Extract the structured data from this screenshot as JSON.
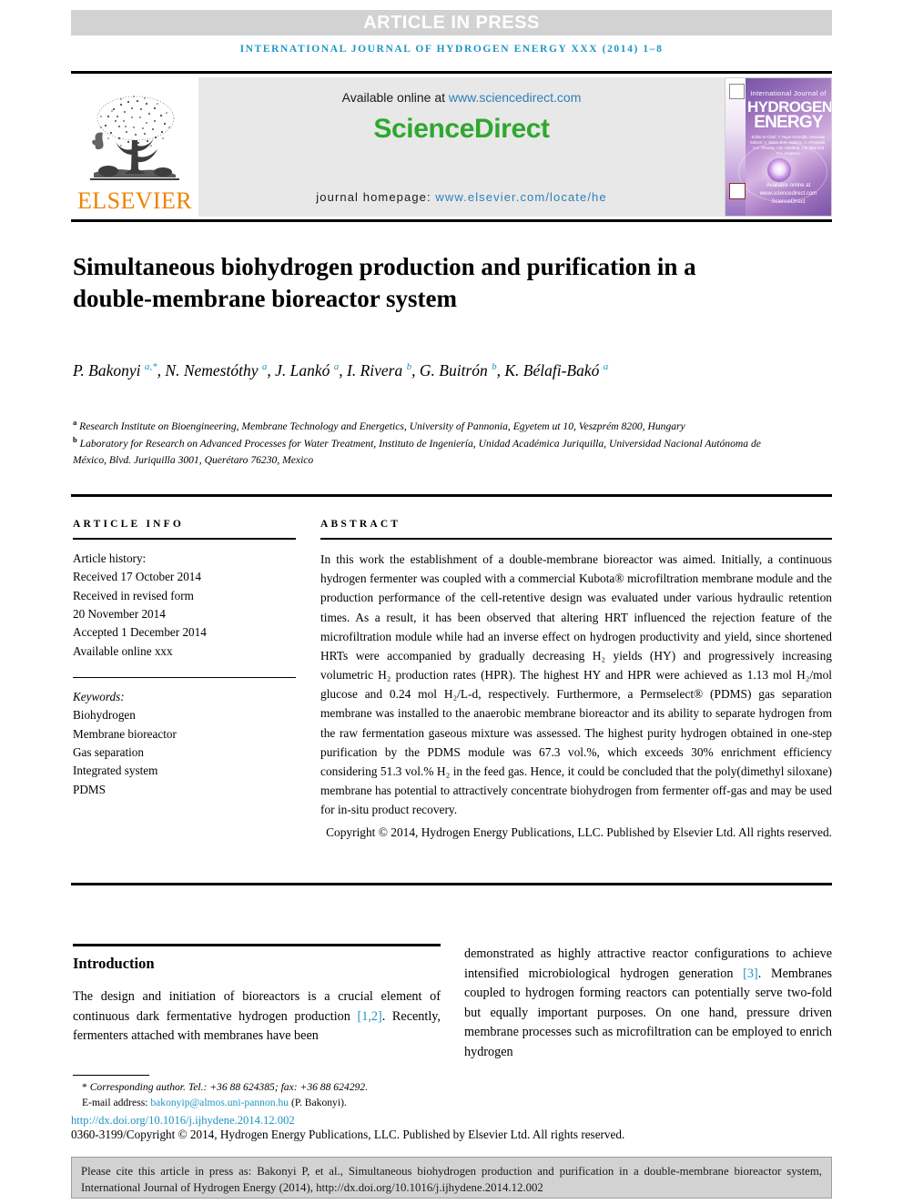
{
  "banner": {
    "text": "ARTICLE IN PRESS",
    "background_color": "#d2d2d2",
    "text_color": "#ffffff"
  },
  "running_head": {
    "text": "INTERNATIONAL JOURNAL OF HYDROGEN ENERGY XXX (2014) 1–8",
    "color": "#1f94c4"
  },
  "masthead": {
    "elsevier_wordmark": "ELSEVIER",
    "elsevier_color": "#ef8200",
    "available_online_prefix": "Available online at ",
    "available_online_url": "www.sciencedirect.com",
    "sciencedirect_logo": "ScienceDirect",
    "sciencedirect_color": "#2ea82e",
    "journal_homepage_label": "journal homepage: ",
    "journal_homepage_url": "www.elsevier.com/locate/he",
    "cover": {
      "small_title": "International Journal of",
      "line1": "HYDROGEN",
      "line2": "ENERGY",
      "editors": "Editor-in-Chief: T. Nejat Veziroğlu\nAssociate Editors: A. Dicks, D.C. Haddon, A. Al-Kuwait A.C. Rhandy, J.W. Sheffield,\nJ.m. Bae and F.A. Amatucci",
      "sciencedirect_caption": "Available online at www.sciencedirect.com\nScienceDirect"
    }
  },
  "article": {
    "title": "Simultaneous biohydrogen production and purification in a double-membrane bioreactor system",
    "authors": [
      {
        "name": "P. Bakonyi",
        "marks": "a,*"
      },
      {
        "name": "N. Nemestóthy",
        "marks": "a"
      },
      {
        "name": "J. Lankó",
        "marks": "a"
      },
      {
        "name": "I. Rivera",
        "marks": "b"
      },
      {
        "name": "G. Buitrón",
        "marks": "b"
      },
      {
        "name": "K. Bélafi-Bakó",
        "marks": "a"
      }
    ],
    "affiliations": [
      {
        "mark": "a",
        "text": "Research Institute on Bioengineering, Membrane Technology and Energetics, University of Pannonia, Egyetem ut 10, Veszprém 8200, Hungary"
      },
      {
        "mark": "b",
        "text": "Laboratory for Research on Advanced Processes for Water Treatment, Instituto de Ingeniería, Unidad Académica Juriquilla, Universidad Nacional Autónoma de México, Blvd. Juriquilla 3001, Querétaro 76230, Mexico"
      }
    ]
  },
  "article_info": {
    "heading": "ARTICLE INFO",
    "history_label": "Article history:",
    "history": [
      "Received 17 October 2014",
      "Received in revised form",
      "20 November 2014",
      "Accepted 1 December 2014",
      "Available online xxx"
    ],
    "keywords_label": "Keywords:",
    "keywords": [
      "Biohydrogen",
      "Membrane bioreactor",
      "Gas separation",
      "Integrated system",
      "PDMS"
    ]
  },
  "abstract": {
    "heading": "ABSTRACT",
    "body": "In this work the establishment of a double-membrane bioreactor was aimed. Initially, a continuous hydrogen fermenter was coupled with a commercial Kubota® microfiltration membrane module and the production performance of the cell-retentive design was evaluated under various hydraulic retention times. As a result, it has been observed that altering HRT influenced the rejection feature of the microfiltration module while had an inverse effect on hydrogen productivity and yield, since shortened HRTs were accompanied by gradually decreasing H₂ yields (HY) and progressively increasing volumetric H₂ production rates (HPR). The highest HY and HPR were achieved as 1.13 mol H₂/mol glucose and 0.24 mol H₂/L-d, respectively. Furthermore, a Permselect® (PDMS) gas separation membrane was installed to the anaerobic membrane bioreactor and its ability to separate hydrogen from the raw fermentation gaseous mixture was assessed. The highest purity hydrogen obtained in one-step purification by the PDMS module was 67.3 vol.%, which exceeds 30% enrichment efficiency considering 51.3 vol.% H₂ in the feed gas. Hence, it could be concluded that the poly(dimethyl siloxane) membrane has potential to attractively concentrate biohydrogen from fermenter off-gas and may be used for in-situ product recovery.",
    "copyright": "Copyright © 2014, Hydrogen Energy Publications, LLC. Published by Elsevier Ltd. All rights reserved."
  },
  "introduction": {
    "heading": "Introduction",
    "left_column": {
      "part1": "The design and initiation of bioreactors is a crucial element of continuous dark fermentative hydrogen production ",
      "ref1": "[1,2]",
      "part2": ". Recently, fermenters attached with membranes have been"
    },
    "right_column": {
      "part1": "demonstrated as highly attractive reactor configurations to achieve intensified microbiological hydrogen generation ",
      "ref1": "[3]",
      "part2": ". Membranes coupled to hydrogen forming reactors can potentially serve two-fold but equally important purposes. On one hand, pressure driven membrane processes such as microfiltration can be employed to enrich hydrogen"
    }
  },
  "footer": {
    "corresponding_author": "Corresponding author. Tel.: +36 88 624385; fax: +36 88 624292.",
    "email_label": "E-mail address: ",
    "email": "bakonyip@almos.uni-pannon.hu",
    "email_owner": " (P. Bakonyi).",
    "doi_url": "http://dx.doi.org/10.1016/j.ijhydene.2014.12.002",
    "issn_line": "0360-3199/Copyright © 2014, Hydrogen Energy Publications, LLC. Published by Elsevier Ltd. All rights reserved.",
    "link_color": "#1f94c4"
  },
  "cite_box": {
    "text": "Please cite this article in press as: Bakonyi P, et al., Simultaneous biohydrogen production and purification in a double-membrane bioreactor system, International Journal of Hydrogen Energy (2014), http://dx.doi.org/10.1016/j.ijhydene.2014.12.002",
    "background_color": "#d2d2d2"
  }
}
